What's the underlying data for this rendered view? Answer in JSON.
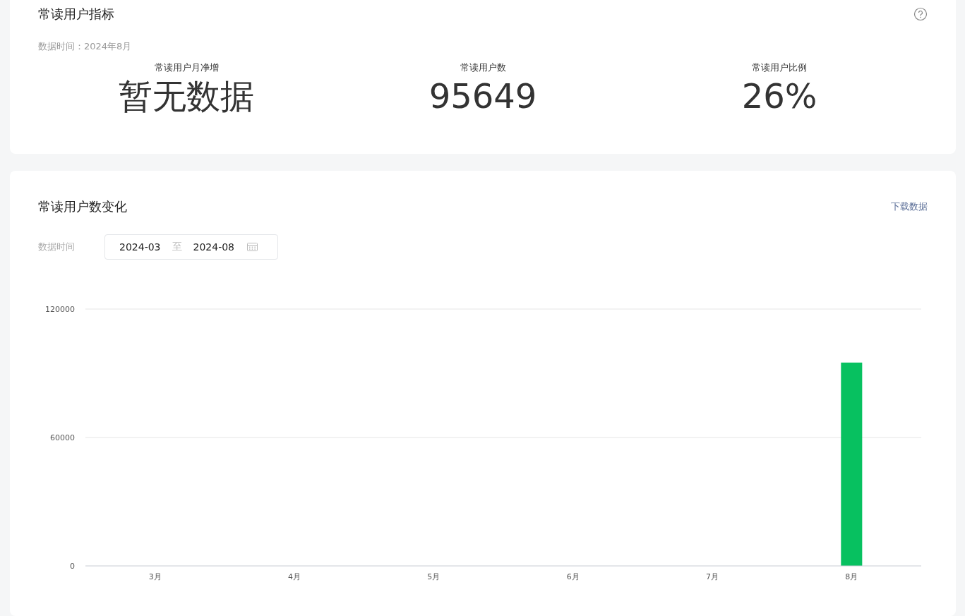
{
  "metrics_card": {
    "title": "常读用户指标",
    "data_time": "数据时间：2024年8月",
    "metrics": [
      {
        "label": "常读用户月净增",
        "value": "暂无数据"
      },
      {
        "label": "常读用户数",
        "value": "95649"
      },
      {
        "label": "常读用户比例",
        "value": "26%"
      }
    ]
  },
  "trend_card": {
    "title": "常读用户数变化",
    "download_link": "下载数据",
    "date_filter": {
      "label": "数据时间",
      "start": "2024-03",
      "separator": "至",
      "end": "2024-08"
    },
    "chart_data": {
      "type": "bar",
      "categories": [
        "3月",
        "4月",
        "5月",
        "6月",
        "7月",
        "8月"
      ],
      "series": [
        {
          "color": "#07c160",
          "values": [
            null,
            null,
            null,
            null,
            null,
            95000
          ]
        }
      ],
      "ylim": [
        0,
        120000
      ],
      "yticks": [
        0,
        60000,
        120000
      ]
    }
  }
}
